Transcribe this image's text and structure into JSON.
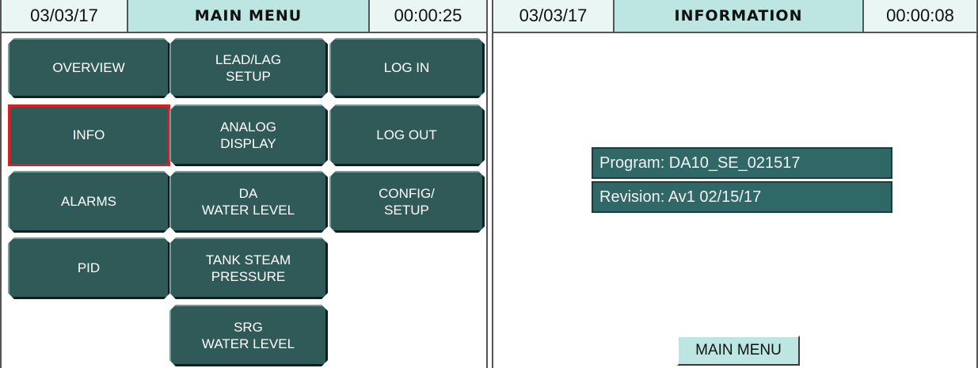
{
  "left_screen": {
    "header": {
      "date": "03/03/17",
      "title": "MAIN MENU",
      "time": "00:00:25"
    },
    "buttons": {
      "overview": "OVERVIEW",
      "lead_lag_setup": "LEAD/LAG\nSETUP",
      "log_in": "LOG IN",
      "info": "INFO",
      "analog_display": "ANALOG\nDISPLAY",
      "log_out": "LOG OUT",
      "alarms": "ALARMS",
      "da_water_level": "DA\nWATER LEVEL",
      "config_setup": "CONFIG/\nSETUP",
      "pid": "PID",
      "tank_steam_pressure": "TANK STEAM\nPRESSURE",
      "srg_water_level": "SRG\nWATER LEVEL"
    },
    "selected_button": "INFO"
  },
  "right_screen": {
    "header": {
      "date": "03/03/17",
      "title": "INFORMATION",
      "time": "00:00:08"
    },
    "program": "Program: DA10_SE_021517",
    "revision": "Revision: Av1 02/15/17",
    "main_menu_button": "MAIN MENU"
  },
  "colors": {
    "button_bg": "#2f5a58",
    "header_title_bg": "#bde6e2",
    "selected_outline": "#d81f26",
    "info_box_bg": "#2f6866"
  }
}
